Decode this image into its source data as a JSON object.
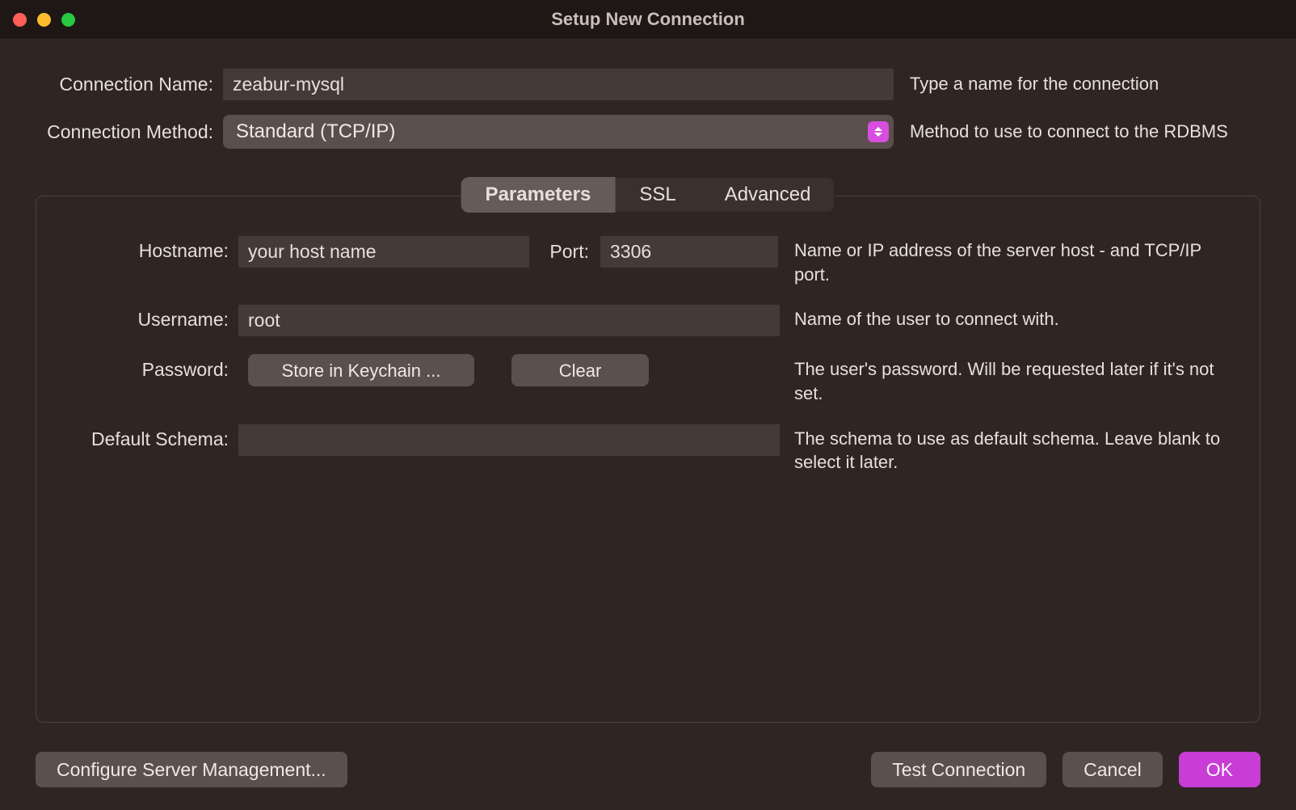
{
  "window": {
    "title": "Setup New Connection"
  },
  "top": {
    "connection_name": {
      "label": "Connection Name:",
      "value": "zeabur-mysql",
      "help": "Type a name for the connection"
    },
    "connection_method": {
      "label": "Connection Method:",
      "value": "Standard (TCP/IP)",
      "help": "Method to use to connect to the RDBMS"
    }
  },
  "tabs": [
    "Parameters",
    "SSL",
    "Advanced"
  ],
  "active_tab": 0,
  "params": {
    "hostname": {
      "label": "Hostname:",
      "value": "your host name",
      "help": "Name or IP address of the server host - and TCP/IP port."
    },
    "port": {
      "label": "Port:",
      "value": "3306"
    },
    "username": {
      "label": "Username:",
      "value": "root",
      "help": "Name of the user to connect with."
    },
    "password": {
      "label": "Password:",
      "store_btn": "Store in Keychain ...",
      "clear_btn": "Clear",
      "help": "The user's password. Will be requested later if it's not set."
    },
    "schema": {
      "label": "Default Schema:",
      "value": "",
      "help": "The schema to use as default schema. Leave blank to select it later."
    }
  },
  "footer": {
    "configure": "Configure Server Management...",
    "test": "Test Connection",
    "cancel": "Cancel",
    "ok": "OK"
  }
}
